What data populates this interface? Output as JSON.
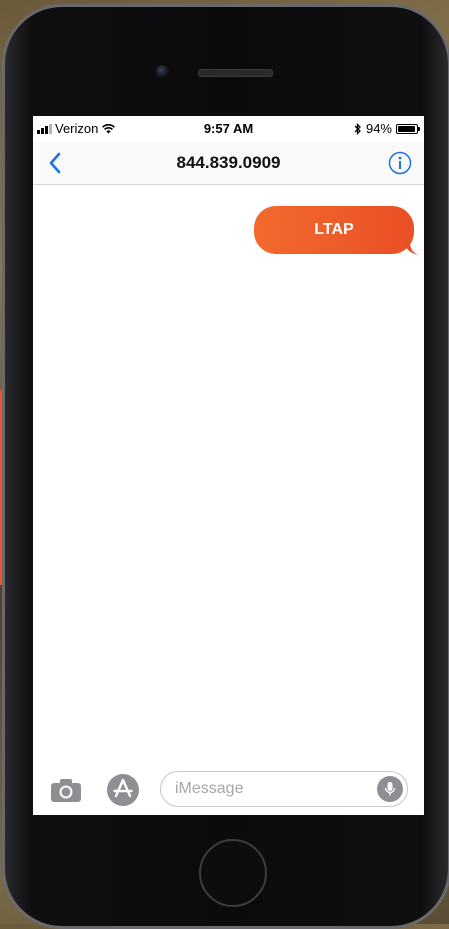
{
  "status_bar": {
    "carrier": "Verizon",
    "time": "9:57 AM",
    "battery_percent": "94%",
    "battery_level": 0.94,
    "wifi_icon": "wifi-icon",
    "bluetooth_icon": "bluetooth-icon"
  },
  "nav": {
    "contact": "844.839.0909",
    "back_icon": "chevron-left-icon",
    "info_icon": "info-icon"
  },
  "messages": [
    {
      "direction": "outgoing",
      "text": "LTAP"
    }
  ],
  "composer": {
    "placeholder": "iMessage",
    "camera_icon": "camera-icon",
    "apps_icon": "app-store-icon",
    "mic_icon": "microphone-icon"
  },
  "colors": {
    "accent_blue": "#1a73e8",
    "bubble_orange": "#f26a2e",
    "bubble_red": "#ea4f26"
  }
}
